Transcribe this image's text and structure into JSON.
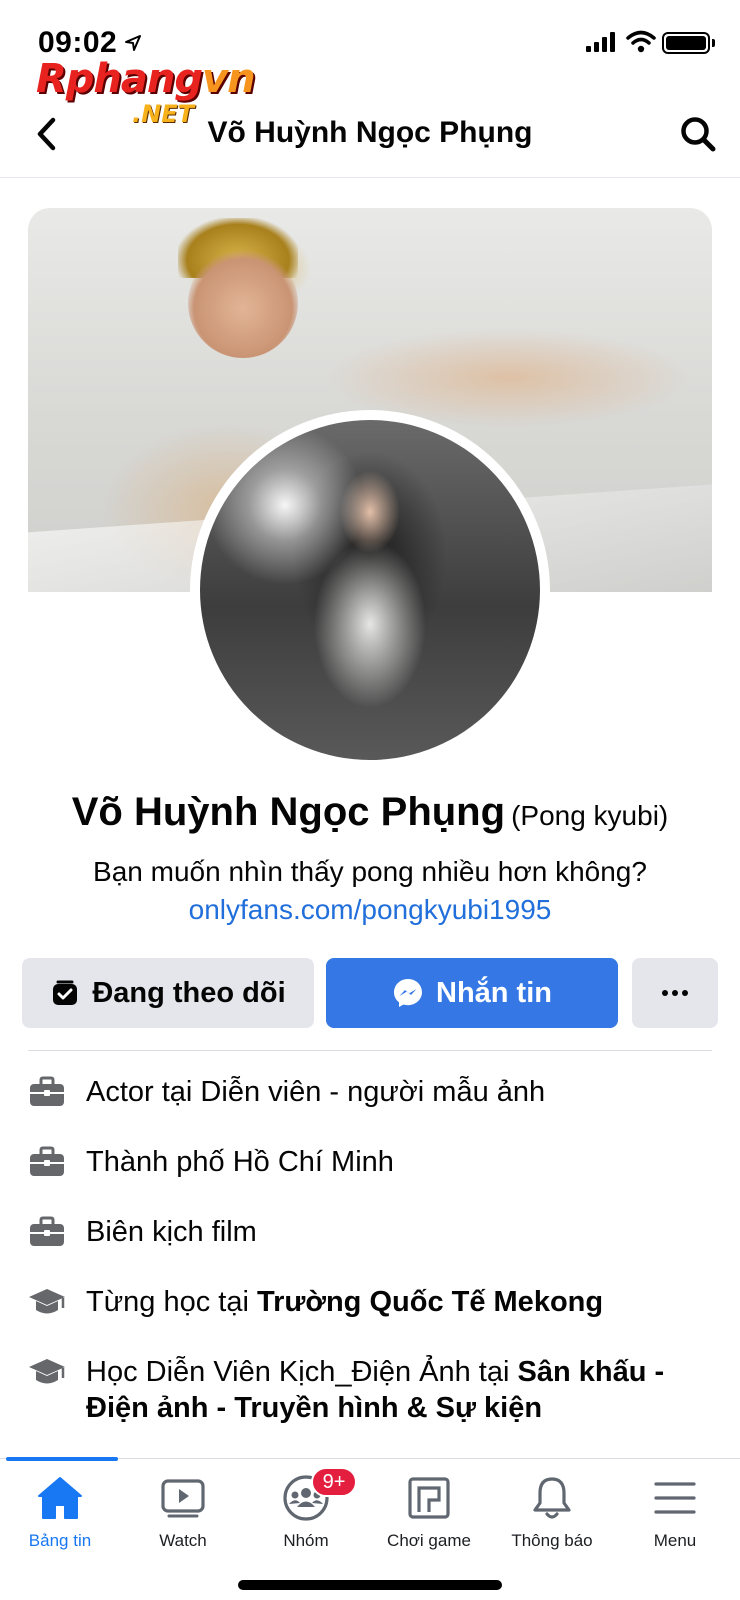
{
  "status_bar": {
    "time": "09:02"
  },
  "watermark": {
    "main_prefix": "Rphang",
    "main_suffix": "vn",
    "sub": ".NET"
  },
  "header": {
    "title": "Võ Huỳnh Ngọc Phụng",
    "back_icon": "chevron-left-icon",
    "search_icon": "search-icon"
  },
  "profile": {
    "name": "Võ Huỳnh Ngọc Phụng",
    "alternate_name": "(Pong kyubi)",
    "bio": "Bạn muốn nhìn thấy pong nhiều hơn không?",
    "link": "onlyfans.com/pongkyubi1995"
  },
  "actions": {
    "follow_label": "Đang theo dõi",
    "message_label": "Nhắn tin",
    "more_label": "···"
  },
  "details": [
    {
      "icon": "briefcase-icon",
      "text": "Actor tại Diễn viên - người mẫu ảnh",
      "bold": ""
    },
    {
      "icon": "briefcase-icon",
      "text": "Thành phố Hồ Chí Minh",
      "bold": ""
    },
    {
      "icon": "briefcase-icon",
      "text": "Biên kịch film",
      "bold": ""
    },
    {
      "icon": "graduation-cap-icon",
      "text": "Từng học tại ",
      "bold": "Trường Quốc Tế Mekong"
    },
    {
      "icon": "graduation-cap-icon",
      "text": "Học Diễn Viên Kịch_Điện Ảnh tại ",
      "bold": "Sân khấu - Điện ảnh - Truyền hình & Sự kiện"
    }
  ],
  "tab_bar": {
    "tabs": [
      {
        "label": "Bảng tin",
        "icon": "home-icon",
        "active": true
      },
      {
        "label": "Watch",
        "icon": "watch-video-icon",
        "active": false
      },
      {
        "label": "Nhóm",
        "icon": "groups-icon",
        "active": false,
        "badge": "9+"
      },
      {
        "label": "Chơi game",
        "icon": "gaming-icon",
        "active": false
      },
      {
        "label": "Thông báo",
        "icon": "bell-icon",
        "active": false
      },
      {
        "label": "Menu",
        "icon": "menu-icon",
        "active": false
      }
    ]
  },
  "colors": {
    "accent": "#1877f2",
    "message_button": "#3578e5",
    "link": "#216fdb",
    "secondary_button": "#e4e6eb",
    "badge": "#e41e3f"
  }
}
